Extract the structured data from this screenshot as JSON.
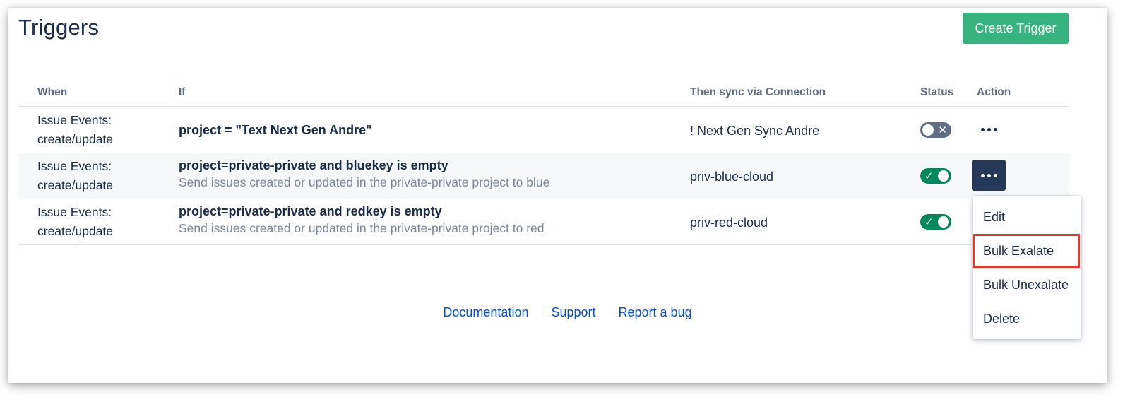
{
  "page": {
    "title": "Triggers",
    "create_button": "Create Trigger"
  },
  "table": {
    "headers": {
      "when": "When",
      "if": "If",
      "connection": "Then sync via Connection",
      "status": "Status",
      "action": "Action"
    },
    "rows": [
      {
        "when_line1": "Issue Events:",
        "when_line2": "create/update",
        "condition": "project = \"Text Next Gen Andre\"",
        "description": "",
        "connection": "! Next Gen Sync Andre",
        "status": "off"
      },
      {
        "when_line1": "Issue Events:",
        "when_line2": "create/update",
        "condition": "project=private-private and bluekey is empty",
        "description": "Send issues created or updated in the private-private project to blue",
        "connection": "priv-blue-cloud",
        "status": "on"
      },
      {
        "when_line1": "Issue Events:",
        "when_line2": "create/update",
        "condition": "project=private-private and redkey is empty",
        "description": "Send issues created or updated in the private-private project to red",
        "connection": "priv-red-cloud",
        "status": "on"
      }
    ]
  },
  "action_menu": {
    "items": [
      "Edit",
      "Bulk Exalate",
      "Bulk Unexalate",
      "Delete"
    ],
    "highlighted": "Bulk Exalate"
  },
  "footer": {
    "links": [
      "Documentation",
      "Support",
      "Report a bug"
    ]
  },
  "colors": {
    "primary_button": "#36b37e",
    "toggle_on": "#00875a",
    "toggle_off": "#5e6c84",
    "active_action": "#253858",
    "link": "#0052cc",
    "highlight_box": "#e03a2f"
  },
  "icons": {
    "toggle_on": "check-icon",
    "toggle_off": "cross-icon",
    "action": "more-horizontal-icon"
  }
}
